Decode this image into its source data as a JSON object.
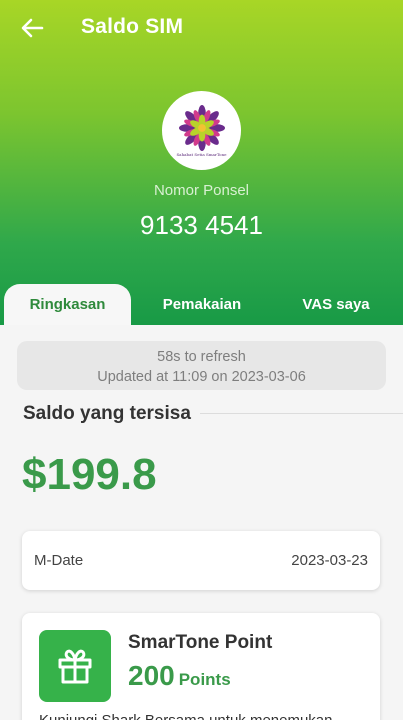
{
  "header": {
    "title": "Saldo SIM",
    "logo_caption": "Sahabat Setia SmarTone",
    "phone_label": "Nomor Ponsel",
    "phone_number": "9133 4541"
  },
  "tabs": [
    {
      "label": "Ringkasan",
      "active": true
    },
    {
      "label": "Pemakaian",
      "active": false
    },
    {
      "label": "VAS saya",
      "active": false
    }
  ],
  "refresh": {
    "countdown": "58s to refresh",
    "updated": "Updated at 11:09 on 2023-03-06"
  },
  "balance": {
    "section_title": "Saldo yang tersisa",
    "amount": "$199.8"
  },
  "mdate": {
    "label": "M-Date",
    "value": "2023-03-23"
  },
  "points": {
    "title": "SmarTone Point",
    "value": "200",
    "unit": "Points",
    "description": "Kunjungi Shark Bersama untuk menemukan"
  },
  "colors": {
    "brand_green": "#3a9a4a",
    "gift_green": "#36b24a",
    "header_top": "#a8d626",
    "header_bottom": "#189a46"
  },
  "icons": {
    "back": "back-arrow-icon",
    "logo": "flower-logo-icon",
    "gift": "gift-icon"
  }
}
